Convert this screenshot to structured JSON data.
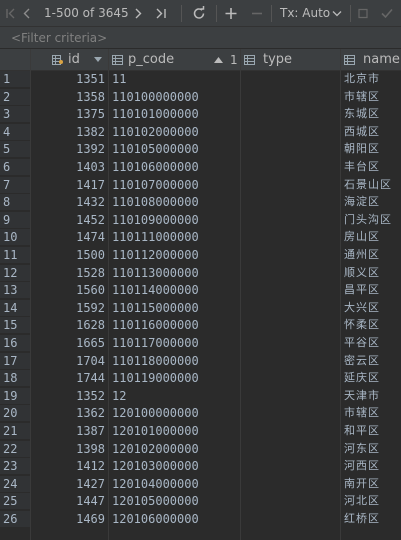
{
  "toolbar": {
    "page_range": "1-500 of 3645",
    "tx_label": "Tx: Auto"
  },
  "filter": {
    "placeholder": "<Filter criteria>"
  },
  "columns": {
    "id": "id",
    "p_code": "p_code",
    "sort_order": "1",
    "type": "type",
    "name": "name"
  },
  "rows": [
    {
      "n": "1",
      "id": "1351",
      "p_code": "11",
      "type": "",
      "name": "北京市"
    },
    {
      "n": "2",
      "id": "1358",
      "p_code": "110100000000",
      "type": "",
      "name": "市辖区"
    },
    {
      "n": "3",
      "id": "1375",
      "p_code": "110101000000",
      "type": "",
      "name": "东城区"
    },
    {
      "n": "4",
      "id": "1382",
      "p_code": "110102000000",
      "type": "",
      "name": "西城区"
    },
    {
      "n": "5",
      "id": "1392",
      "p_code": "110105000000",
      "type": "",
      "name": "朝阳区"
    },
    {
      "n": "6",
      "id": "1403",
      "p_code": "110106000000",
      "type": "",
      "name": "丰台区"
    },
    {
      "n": "7",
      "id": "1417",
      "p_code": "110107000000",
      "type": "",
      "name": "石景山区"
    },
    {
      "n": "8",
      "id": "1432",
      "p_code": "110108000000",
      "type": "",
      "name": "海淀区"
    },
    {
      "n": "9",
      "id": "1452",
      "p_code": "110109000000",
      "type": "",
      "name": "门头沟区"
    },
    {
      "n": "10",
      "id": "1474",
      "p_code": "110111000000",
      "type": "",
      "name": "房山区"
    },
    {
      "n": "11",
      "id": "1500",
      "p_code": "110112000000",
      "type": "",
      "name": "通州区"
    },
    {
      "n": "12",
      "id": "1528",
      "p_code": "110113000000",
      "type": "",
      "name": "顺义区"
    },
    {
      "n": "13",
      "id": "1560",
      "p_code": "110114000000",
      "type": "",
      "name": "昌平区"
    },
    {
      "n": "14",
      "id": "1592",
      "p_code": "110115000000",
      "type": "",
      "name": "大兴区"
    },
    {
      "n": "15",
      "id": "1628",
      "p_code": "110116000000",
      "type": "",
      "name": "怀柔区"
    },
    {
      "n": "16",
      "id": "1665",
      "p_code": "110117000000",
      "type": "",
      "name": "平谷区"
    },
    {
      "n": "17",
      "id": "1704",
      "p_code": "110118000000",
      "type": "",
      "name": "密云区"
    },
    {
      "n": "18",
      "id": "1744",
      "p_code": "110119000000",
      "type": "",
      "name": "延庆区"
    },
    {
      "n": "19",
      "id": "1352",
      "p_code": "12",
      "type": "",
      "name": "天津市"
    },
    {
      "n": "20",
      "id": "1362",
      "p_code": "120100000000",
      "type": "",
      "name": "市辖区"
    },
    {
      "n": "21",
      "id": "1387",
      "p_code": "120101000000",
      "type": "",
      "name": "和平区"
    },
    {
      "n": "22",
      "id": "1398",
      "p_code": "120102000000",
      "type": "",
      "name": "河东区"
    },
    {
      "n": "23",
      "id": "1412",
      "p_code": "120103000000",
      "type": "",
      "name": "河西区"
    },
    {
      "n": "24",
      "id": "1427",
      "p_code": "120104000000",
      "type": "",
      "name": "南开区"
    },
    {
      "n": "25",
      "id": "1447",
      "p_code": "120105000000",
      "type": "",
      "name": "河北区"
    },
    {
      "n": "26",
      "id": "1469",
      "p_code": "120106000000",
      "type": "",
      "name": "红桥区"
    }
  ],
  "icons": {
    "first": "first-page-icon",
    "prev": "prev-page-icon",
    "next": "next-page-icon",
    "last": "last-page-icon",
    "refresh": "refresh-icon",
    "add": "add-row-icon",
    "remove": "remove-row-icon",
    "commit": "commit-icon",
    "key": "primary-key-column-icon",
    "column": "column-icon",
    "sort": "sort-ascending-icon"
  },
  "colors": {
    "background": "#2b2b2b",
    "toolbar": "#3c3f41",
    "text": "#a9b7c6",
    "key": "#d9a343"
  }
}
